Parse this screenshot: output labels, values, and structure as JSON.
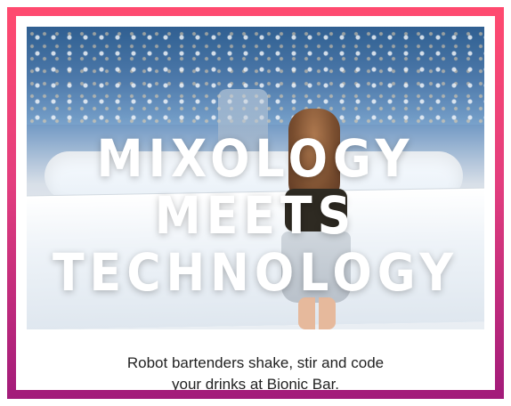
{
  "headline": {
    "line1": "MIXOLOGY MEETS",
    "line2": "TECHNOLOGY"
  },
  "caption": {
    "line1": "Robot bartenders shake, stir and code",
    "line2": "your drinks at Bionic Bar."
  },
  "colors": {
    "frame_top": "#ff4a6f",
    "frame_bottom": "#a21b7a",
    "headline": "#ffffff",
    "caption_text": "#222222"
  }
}
